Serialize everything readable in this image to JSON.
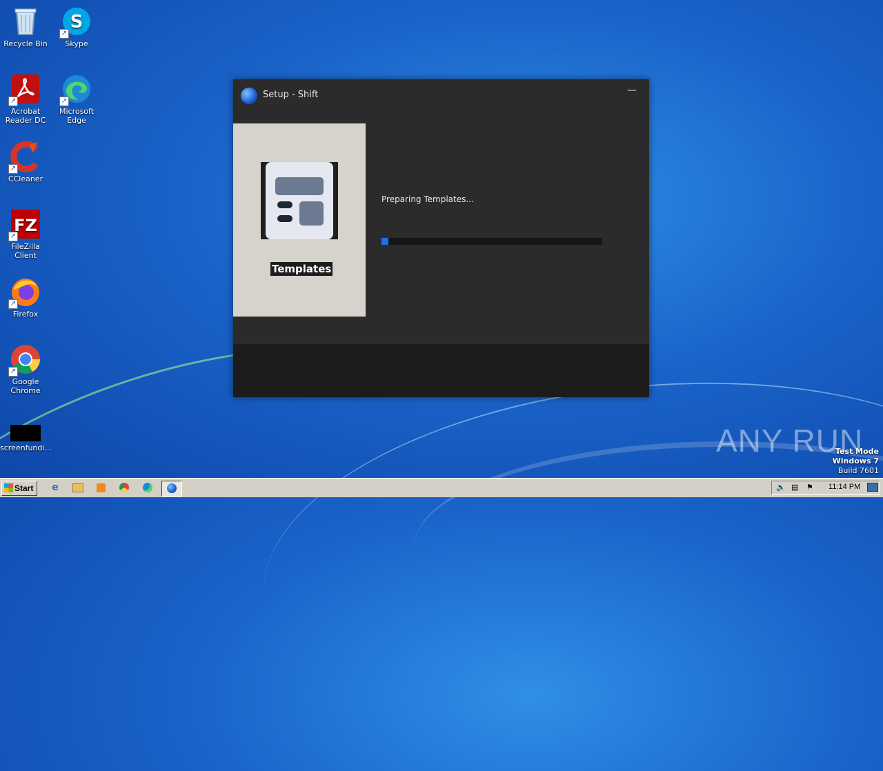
{
  "desktop": {
    "icons": [
      {
        "label": "Recycle Bin"
      },
      {
        "label": "Skype"
      },
      {
        "label": "Acrobat Reader DC"
      },
      {
        "label": "Microsoft Edge"
      },
      {
        "label": "CCleaner"
      },
      {
        "label": "FileZilla Client"
      },
      {
        "label": "Firefox"
      },
      {
        "label": "Google Chrome"
      },
      {
        "label": "screenfundi..."
      }
    ]
  },
  "window": {
    "title": "Setup - Shift",
    "minimize_glyph": "—",
    "side_label": "Templates",
    "status": "Preparing Templates...",
    "progress_fraction": 0.03
  },
  "watermark": {
    "brand": "ANY RUN",
    "mode": "Test Mode",
    "os": "Windows 7",
    "build": "Build 7601"
  },
  "taskbar": {
    "start_label": "Start",
    "clock": "11:14 PM"
  },
  "colors": {
    "progress": "#1a73e8",
    "window_bg": "#2b2b2b",
    "side_panel": "#d6d2cc"
  }
}
